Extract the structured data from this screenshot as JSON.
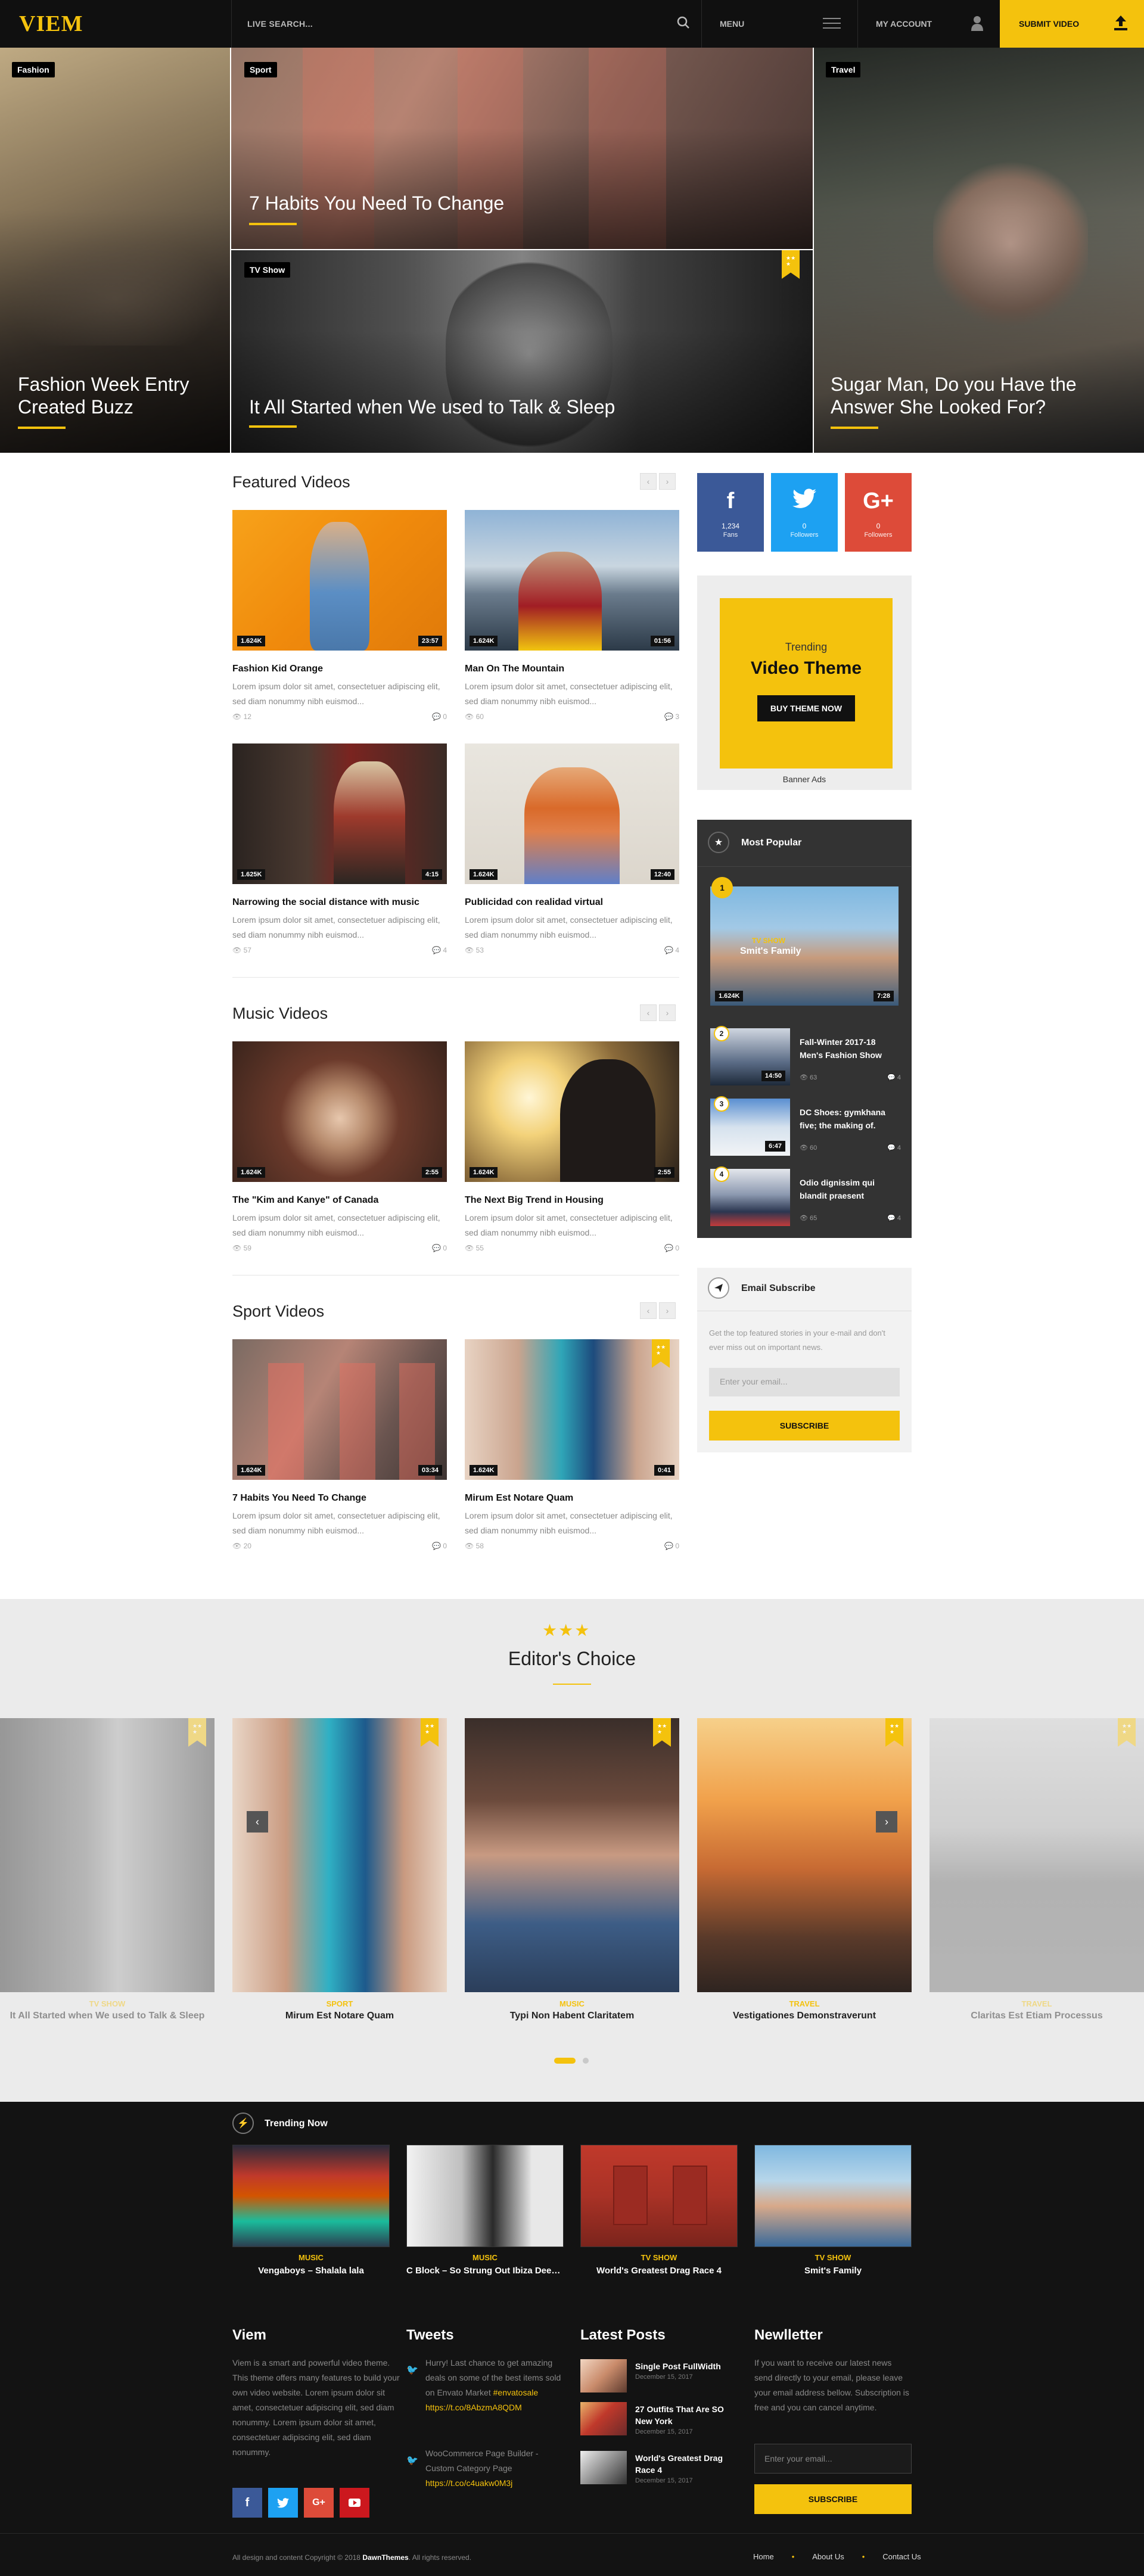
{
  "header": {
    "logo": "VIEM",
    "search_placeholder": "LIVE SEARCH...",
    "menu_label": "MENU",
    "account_label": "MY ACCOUNT",
    "submit_label": "SUBMIT VIDEO",
    "icons": [
      "search-icon",
      "hamburger-icon",
      "user-icon",
      "upload-icon"
    ]
  },
  "hero": [
    {
      "tag": "Fashion",
      "title": "Fashion Week Entry Created Buzz"
    },
    {
      "tag": "Sport",
      "title": "7 Habits You Need To Change"
    },
    {
      "tag": "TV Show",
      "title": "It All Started when We used to Talk & Sleep"
    },
    {
      "tag": "Travel",
      "title": "Sugar Man, Do you Have the Answer She Looked For?"
    }
  ],
  "featured": {
    "heading": "Featured Videos",
    "items": [
      {
        "title": "Fashion Kid Orange",
        "likes": "1.624K",
        "duration": "23:57",
        "excerpt": "Lorem ipsum dolor sit amet, consectetuer adipiscing elit, sed diam nonummy nibh euismod...",
        "views": "12",
        "comments": "0"
      },
      {
        "title": "Man On The Mountain",
        "likes": "1.624K",
        "duration": "01:56",
        "excerpt": "Lorem ipsum dolor sit amet, consectetuer adipiscing elit, sed diam nonummy nibh euismod...",
        "views": "60",
        "comments": "3"
      },
      {
        "title": "Narrowing the social distance with music",
        "likes": "1.625K",
        "duration": "4:15",
        "excerpt": "Lorem ipsum dolor sit amet, consectetuer adipiscing elit, sed diam nonummy nibh euismod...",
        "views": "57",
        "comments": "4"
      },
      {
        "title": "Publicidad con realidad virtual",
        "likes": "1.624K",
        "duration": "12:40",
        "excerpt": "Lorem ipsum dolor sit amet, consectetuer adipiscing elit, sed diam nonummy nibh euismod...",
        "views": "53",
        "comments": "4"
      }
    ]
  },
  "music": {
    "heading": "Music Videos",
    "items": [
      {
        "title": "The \"Kim and Kanye\" of Canada",
        "likes": "1.624K",
        "duration": "2:55",
        "excerpt": "Lorem ipsum dolor sit amet, consectetuer adipiscing elit, sed diam nonummy nibh euismod...",
        "views": "59",
        "comments": "0"
      },
      {
        "title": "The Next Big Trend in Housing",
        "likes": "1.624K",
        "duration": "2:55",
        "excerpt": "Lorem ipsum dolor sit amet, consectetuer adipiscing elit, sed diam nonummy nibh euismod...",
        "views": "55",
        "comments": "0"
      }
    ]
  },
  "sport": {
    "heading": "Sport Videos",
    "items": [
      {
        "title": "7 Habits You Need To Change",
        "likes": "1.624K",
        "duration": "03:34",
        "excerpt": "Lorem ipsum dolor sit amet, consectetuer adipiscing elit, sed diam nonummy nibh euismod...",
        "views": "20",
        "comments": "0"
      },
      {
        "title": "Mirum Est Notare Quam",
        "likes": "1.624K",
        "duration": "0:41",
        "excerpt": "Lorem ipsum dolor sit amet, consectetuer adipiscing elit, sed diam nonummy nibh euismod...",
        "views": "58",
        "comments": "0"
      }
    ]
  },
  "social": [
    {
      "icon": "f",
      "count": "1,234",
      "label": "Fans",
      "color": "#3b5998"
    },
    {
      "icon": "t",
      "count": "0",
      "label": "Followers",
      "color": "#1da1f2"
    },
    {
      "icon": "G+",
      "count": "0",
      "label": "Followers",
      "color": "#dd4b39"
    }
  ],
  "ad": {
    "small": "Trending",
    "big": "Video Theme",
    "button": "BUY THEME NOW",
    "caption": "Banner Ads"
  },
  "popular": {
    "heading": "Most Popular",
    "feature": {
      "num": "1",
      "tag": "TV SHOW",
      "title": "Smit's Family",
      "likes": "1.624K",
      "duration": "7:28"
    },
    "items": [
      {
        "num": "2",
        "title": "Fall-Winter 2017-18 Men's Fashion Show",
        "duration": "14:50",
        "views": "63",
        "comments": "4"
      },
      {
        "num": "3",
        "title": "DC Shoes: gymkhana five; the making of.",
        "duration": "6:47",
        "views": "60",
        "comments": "4"
      },
      {
        "num": "4",
        "title": "Odio dignissim qui blandit praesent",
        "duration": "",
        "views": "65",
        "comments": "4"
      }
    ]
  },
  "subscribe": {
    "heading": "Email Subscribe",
    "text": "Get the top featured stories in your e-mail and don't ever miss out on important news.",
    "placeholder": "Enter your email...",
    "button": "SUBSCRIBE"
  },
  "editors": {
    "heading": "Editor's Choice",
    "items": [
      {
        "cat": "TV SHOW",
        "title": "It All Started when We used to Talk & Sleep"
      },
      {
        "cat": "SPORT",
        "title": "Mirum Est Notare Quam"
      },
      {
        "cat": "MUSIC",
        "title": "Typi Non Habent Claritatem"
      },
      {
        "cat": "TRAVEL",
        "title": "Vestigationes Demonstraverunt"
      },
      {
        "cat": "TRAVEL",
        "title": "Claritas Est Etiam Processus"
      }
    ]
  },
  "trending": {
    "heading": "Trending Now",
    "items": [
      {
        "cat": "MUSIC",
        "title": "Vengaboys – Shalala lala"
      },
      {
        "cat": "MUSIC",
        "title": "C Block – So Strung Out Ibiza Deep S..."
      },
      {
        "cat": "TV SHOW",
        "title": "World's Greatest Drag Race 4"
      },
      {
        "cat": "TV SHOW",
        "title": "Smit's Family"
      }
    ]
  },
  "footer": {
    "about_heading": "Viem",
    "about_text": "Viem is a smart and powerful video theme. This theme offers many features to build your own video website. Lorem ipsum dolor sit amet, consectetuer adipiscing elit, sed diam nonummy. Lorem ipsum dolor sit amet, consectetuer adipiscing elit, sed diam nonummy.",
    "tweets_heading": "Tweets",
    "tweets": [
      {
        "text": "Hurry! Last chance to get amazing deals on some of the best items sold on Envato Market",
        "link": "#envatosale https://t.co/8AbzmA8QDM"
      },
      {
        "text": "WooCommerce Page Builder - Custom Category Page",
        "link": "https://t.co/c4uakw0M3j"
      }
    ],
    "posts_heading": "Latest Posts",
    "posts": [
      {
        "title": "Single Post FullWidth",
        "date": "December 15, 2017"
      },
      {
        "title": "27 Outfits That Are SO New York",
        "date": "December 15, 2017"
      },
      {
        "title": "World's Greatest Drag Race 4",
        "date": "December 15, 2017"
      }
    ],
    "newsletter_heading": "Newlletter",
    "newsletter_text": "If you want to receive our latest news send directly to your email, please leave your email address bellow. Subscription is free and you can cancel anytime.",
    "newsletter_placeholder": "Enter your email...",
    "newsletter_button": "SUBSCRIBE",
    "copyright_a": "All design and content Copyright © 2018 ",
    "copyright_b": "DawnThemes",
    "copyright_c": ". All rights reserved.",
    "links": [
      "Home",
      "About Us",
      "Contact Us"
    ]
  },
  "colors": {
    "accent": "#f4c20d",
    "dark": "#101010"
  }
}
